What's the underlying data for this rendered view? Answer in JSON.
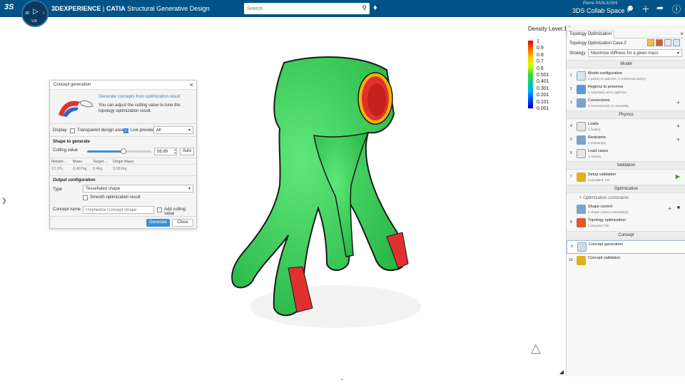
{
  "topbar": {
    "logo": "3S",
    "compass": {
      "label_3d": "3D",
      "label_i": "i",
      "version": "V,R"
    },
    "brand": "3DEXPERIENCE",
    "product": "CATIA",
    "app": "Structural Generative Design",
    "search_placeholder": "Search",
    "user": "Pierre PASLIUSHI",
    "space": "3DS Collab Space"
  },
  "legend": {
    "title": "Density Level.1",
    "values": [
      "1",
      "0.9",
      "0.8",
      "0.7",
      "0.6",
      "0.501",
      "0.401",
      "0.301",
      "0.201",
      "0.101",
      "0.001"
    ],
    "colors": {
      "high": "#d40000",
      "mid": "#33dd33",
      "low": "#0000aa"
    }
  },
  "dialog": {
    "title": "Concept generation",
    "link": "Generate concepts from optimization result",
    "description": "You can adjust the cutting value to tune the topology optimization result.",
    "display_label": "Display",
    "transparent_label": "Transparent design area",
    "live_preview_label": "Live preview",
    "display_select": "All",
    "shape_section": "Shape to generate",
    "cutting_label": "Cutting value",
    "cutting_value": "56.89",
    "cutting_fraction": 0.5689,
    "auto_label": "Auto",
    "table": {
      "headers": [
        "Relativ...",
        "Mass",
        "Target ...",
        "Origin Mass"
      ],
      "row": [
        "13.3%",
        "0.407kg",
        "0.4kg",
        "3.051kg"
      ]
    },
    "output_section": "Output configuration",
    "type_label": "Type",
    "type_value": "Tessellated shape",
    "smooth_label": "Smooth optimization result",
    "concept_name_label": "Concept name",
    "concept_name_placeholder": "Polyhedral Concept Shape",
    "add_cutting_label": "Add cutting value",
    "generate_label": "Generate",
    "close_label": "Close"
  },
  "panel": {
    "tab_title": "Topology Optimization",
    "case_name": "Topology Optimization Case.2",
    "strategy_label": "Strategy",
    "strategy_value": "Maximize stiffness for a given mass",
    "sections": {
      "model": "Model",
      "physics": "Physics",
      "validation": "Validation",
      "optimization": "Optimization",
      "concept": "Concept"
    },
    "items": {
      "model_config": {
        "num": "1",
        "title": "Model configuration",
        "sub": "1 part(s) to optimize, 0 contextual part(s)"
      },
      "regions": {
        "num": "2",
        "title": "Regions to preserve",
        "sub": "1 volume(s) set to optimize"
      },
      "connections": {
        "num": "3",
        "title": "Connections",
        "sub": "0 connection(s) on assembly"
      },
      "loads": {
        "num": "4",
        "title": "Loads",
        "sub": "1 load(s)"
      },
      "restraints": {
        "num": "5",
        "title": "Restraints",
        "sub": "1 restraint(s)"
      },
      "load_cases": {
        "num": "6",
        "title": "Load cases",
        "sub": "1 case(s)"
      },
      "setup_validation": {
        "num": "7",
        "title": "Setup validation",
        "sub": "Calculated: KO"
      },
      "opt_constraints": {
        "title": "Optimization constraints"
      },
      "shape_control": {
        "title": "Shape control",
        "sub": "2 shape control constraint(s)"
      },
      "topology_opt": {
        "num": "8",
        "title": "Topology optimization",
        "sub": "Computed: OK"
      },
      "concept_gen": {
        "num": "9",
        "title": "Concept generation"
      },
      "concept_val": {
        "num": "10",
        "title": "Concept validation"
      }
    }
  }
}
